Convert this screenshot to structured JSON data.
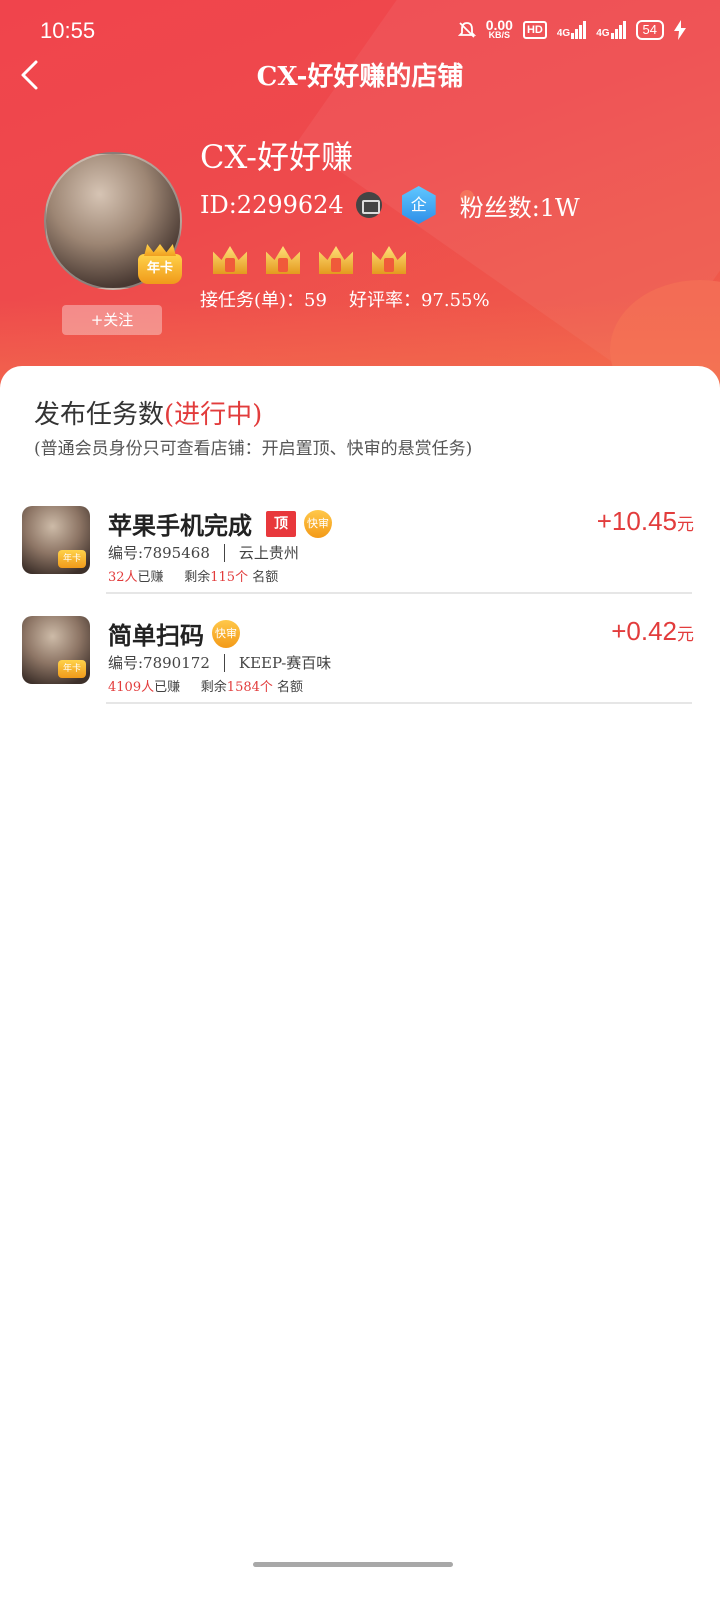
{
  "status_bar": {
    "time": "10:55",
    "net_speed": "0.00",
    "net_unit": "KB/S",
    "hd": "HD",
    "sig1": "4G",
    "sig2": "4G",
    "battery": "54"
  },
  "nav": {
    "title": "CX-好好赚的店铺"
  },
  "profile": {
    "name": "CX-好好赚",
    "id_text": "ID:2299624",
    "qi_label": "企",
    "fans_text": "粉丝数:1W",
    "year_card": "年卡",
    "follow_label": "+关注",
    "tasks_text": "接任务(单)：59",
    "rating_text": "好评率：97.55%",
    "crown_count": 4
  },
  "section": {
    "title": "发布任务数",
    "status": "(进行中)",
    "subtitle": "(普通会员身份只可查看店铺：开启置顶、快审的悬赏任务)"
  },
  "tasks": [
    {
      "title": "苹果手机完成",
      "top_tag": "顶",
      "fast_tag": "快审",
      "number": "编号:7895468",
      "category": "云上贵州",
      "earned_count": "32人",
      "earned_label": "已赚",
      "remain_label": "剩余",
      "remain_count": "115个",
      "quota_label": "名额",
      "price": "+10.45",
      "unit": "元",
      "badge": "年卡"
    },
    {
      "title": "简单扫码",
      "fast_tag": "快审",
      "number": "编号:7890172",
      "category": "KEEP-赛百味",
      "earned_count": "4109人",
      "earned_label": "已赚",
      "remain_label": "剩余",
      "remain_count": "1584个",
      "quota_label": "名额",
      "price": "+0.42",
      "unit": "元",
      "badge": "年卡"
    }
  ]
}
